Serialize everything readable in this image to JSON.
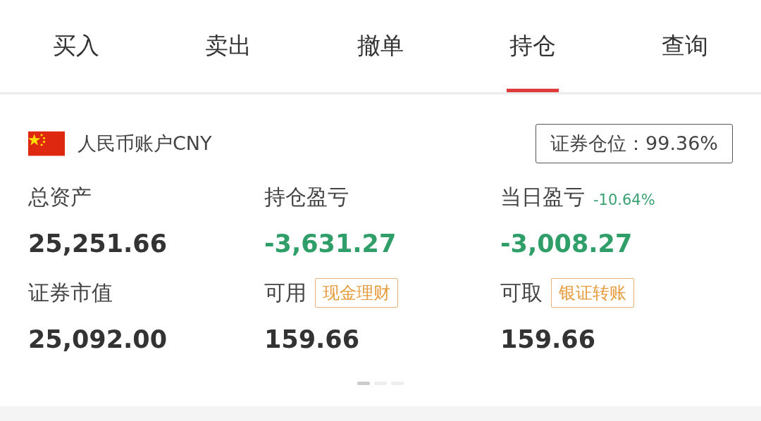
{
  "tabs": [
    {
      "label": "买入",
      "selected": false
    },
    {
      "label": "卖出",
      "selected": false
    },
    {
      "label": "撤单",
      "selected": false
    },
    {
      "label": "持仓",
      "selected": true
    },
    {
      "label": "查询",
      "selected": false
    }
  ],
  "account": {
    "name": "人民币账户CNY",
    "position": "证券仓位：99.36%"
  },
  "metrics": [
    {
      "label": "总资产",
      "value": "25,251.66",
      "negative": false
    },
    {
      "label": "持仓盈亏",
      "value": "-3,631.27",
      "negative": true
    },
    {
      "label": "当日盈亏",
      "change": "-10.64%",
      "value": "-3,008.27",
      "negative": true
    },
    {
      "label": "证券市值",
      "value": "25,092.00",
      "negative": false
    },
    {
      "label": "可用",
      "tag": "现金理财",
      "value": "159.66",
      "negative": false
    },
    {
      "label": "可取",
      "tag": "银证转账",
      "value": "159.66",
      "negative": false
    }
  ],
  "pager": [
    {
      "selected": true
    },
    {
      "selected": false
    },
    {
      "selected": false
    }
  ]
}
